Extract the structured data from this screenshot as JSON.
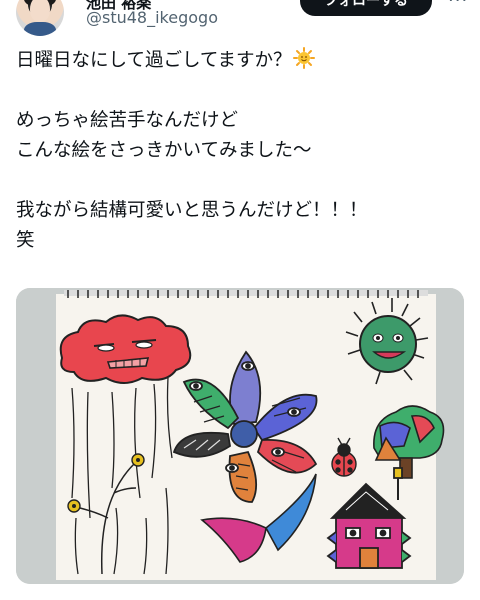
{
  "post": {
    "display_name": "池田 裕楽",
    "handle": "@stu48_ikegogo",
    "follow_label": "フォローする",
    "more_label": "···",
    "lines": [
      "日曜日なにして過ごしてますか？",
      "",
      "めっちゃ絵苦手なんだけど",
      "こんな絵をさっきかいてみました〜",
      "",
      "我ながら結構可愛いと思うんだけど！！！",
      "笑"
    ],
    "emoji": "sun-with-face-icon"
  },
  "media": {
    "description_icon": "drawing-image",
    "colors": {
      "cloud": "#e8464e",
      "sun": "#3d9a6a",
      "paper": "#f7f4ee",
      "backdrop": "#cfd3d3"
    }
  }
}
